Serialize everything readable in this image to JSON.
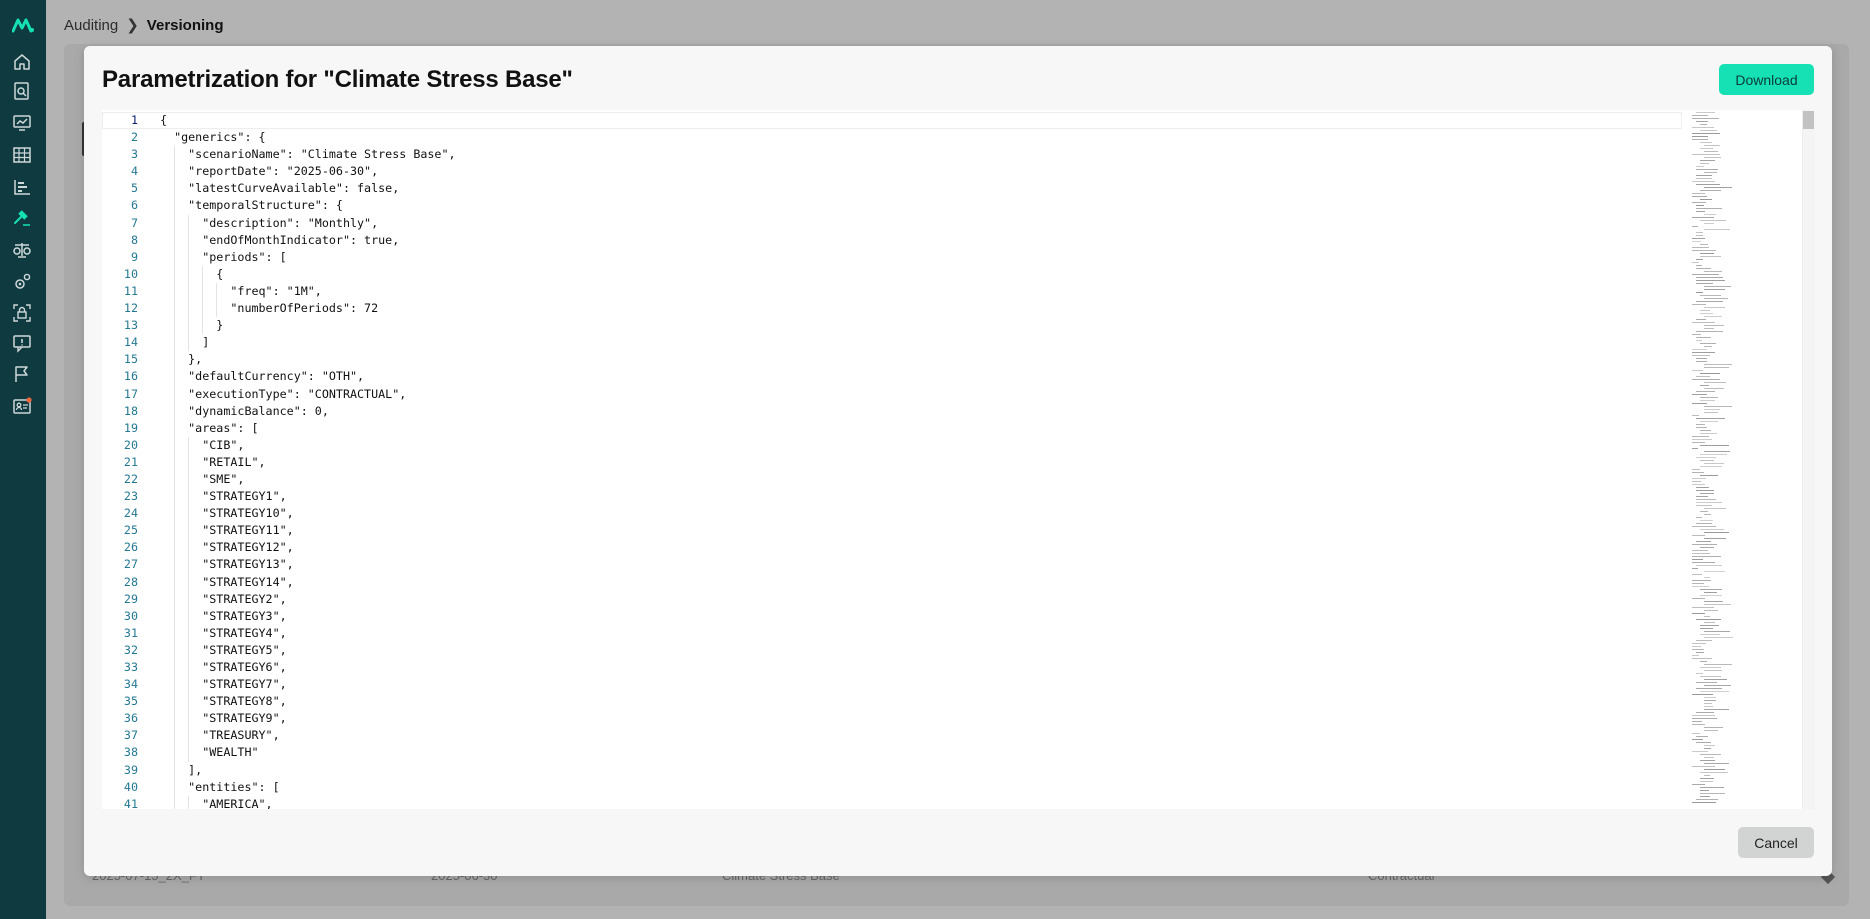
{
  "breadcrumb": {
    "parent": "Auditing",
    "current": "Versioning"
  },
  "background_row": {
    "col1": "2025-07-15_2X_FY",
    "col2": "2025-06-30",
    "col3": "Climate Stress Base",
    "col4": "Contractual"
  },
  "modal": {
    "title": "Parametrization for \"Climate Stress Base\"",
    "download_label": "Download",
    "cancel_label": "Cancel"
  },
  "colors": {
    "sidebar": "#0e3a40",
    "accent": "#16e1b4",
    "line_number": "#237893"
  },
  "sidebar_icons": [
    "logo-icon",
    "home-icon",
    "search-document-icon",
    "monitor-chart-icon",
    "table-icon",
    "bar-chart-icon",
    "gavel-icon",
    "scale-icon",
    "gears-icon",
    "lock-icon",
    "alert-icon",
    "flag-icon",
    "id-card-icon"
  ],
  "code_lines": [
    "{",
    "  \"generics\": {",
    "    \"scenarioName\": \"Climate Stress Base\",",
    "    \"reportDate\": \"2025-06-30\",",
    "    \"latestCurveAvailable\": false,",
    "    \"temporalStructure\": {",
    "      \"description\": \"Monthly\",",
    "      \"endOfMonthIndicator\": true,",
    "      \"periods\": [",
    "        {",
    "          \"freq\": \"1M\",",
    "          \"numberOfPeriods\": 72",
    "        }",
    "      ]",
    "    },",
    "    \"defaultCurrency\": \"OTH\",",
    "    \"executionType\": \"CONTRACTUAL\",",
    "    \"dynamicBalance\": 0,",
    "    \"areas\": [",
    "      \"CIB\",",
    "      \"RETAIL\",",
    "      \"SME\",",
    "      \"STRATEGY1\",",
    "      \"STRATEGY10\",",
    "      \"STRATEGY11\",",
    "      \"STRATEGY12\",",
    "      \"STRATEGY13\",",
    "      \"STRATEGY14\",",
    "      \"STRATEGY2\",",
    "      \"STRATEGY3\",",
    "      \"STRATEGY4\",",
    "      \"STRATEGY5\",",
    "      \"STRATEGY6\",",
    "      \"STRATEGY7\",",
    "      \"STRATEGY8\",",
    "      \"STRATEGY9\",",
    "      \"TREASURY\",",
    "      \"WEALTH\"",
    "    ],",
    "    \"entities\": [",
    "      \"AMERICA\","
  ]
}
